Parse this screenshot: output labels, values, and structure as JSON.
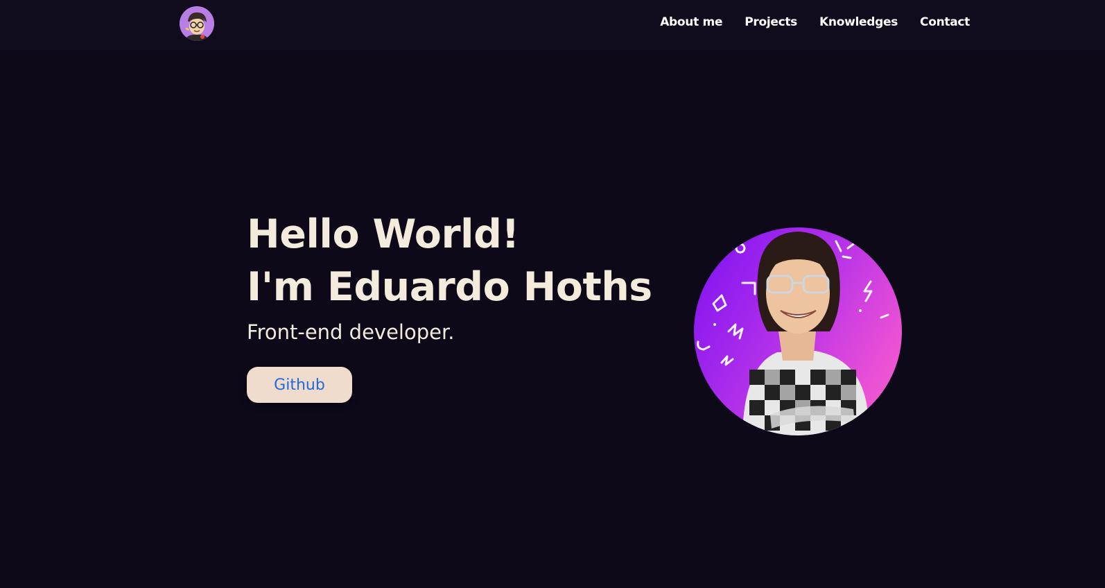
{
  "nav": {
    "links": [
      {
        "label": "About me"
      },
      {
        "label": "Projects"
      },
      {
        "label": "Knowledges"
      },
      {
        "label": "Contact"
      }
    ]
  },
  "hero": {
    "title_line1": "Hello World!",
    "title_line2": "I'm Eduardo Hoths",
    "subtitle": "Front-end developer.",
    "github_label": "Github"
  },
  "colors": {
    "background": "#0d0919",
    "navbar": "#100c1d",
    "text": "#f3ecdd",
    "button_bg": "#efdccd",
    "button_text": "#1e6ae0",
    "avatar_gradient_start": "#7b10f2",
    "avatar_gradient_end": "#f463c9"
  }
}
